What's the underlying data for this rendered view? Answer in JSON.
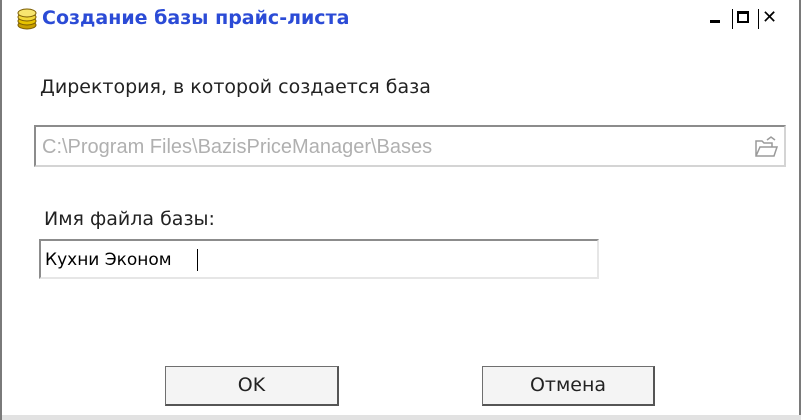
{
  "window": {
    "title": "Создание базы прайс-листа",
    "title_color": "#2b4bd6",
    "icons": {
      "app": "coins-icon",
      "minimize": "minimize-icon",
      "maximize": "maximize-icon",
      "close": "close-icon",
      "browse": "folder-open-icon"
    }
  },
  "form": {
    "directory_label": "Директория, в которой создается база",
    "directory_value": "C:\\Program Files\\BazisPriceManager\\Bases",
    "filename_label": "Имя файла базы:",
    "filename_value": "Кухни Эконом"
  },
  "buttons": {
    "ok": "OK",
    "cancel": "Отмена"
  }
}
